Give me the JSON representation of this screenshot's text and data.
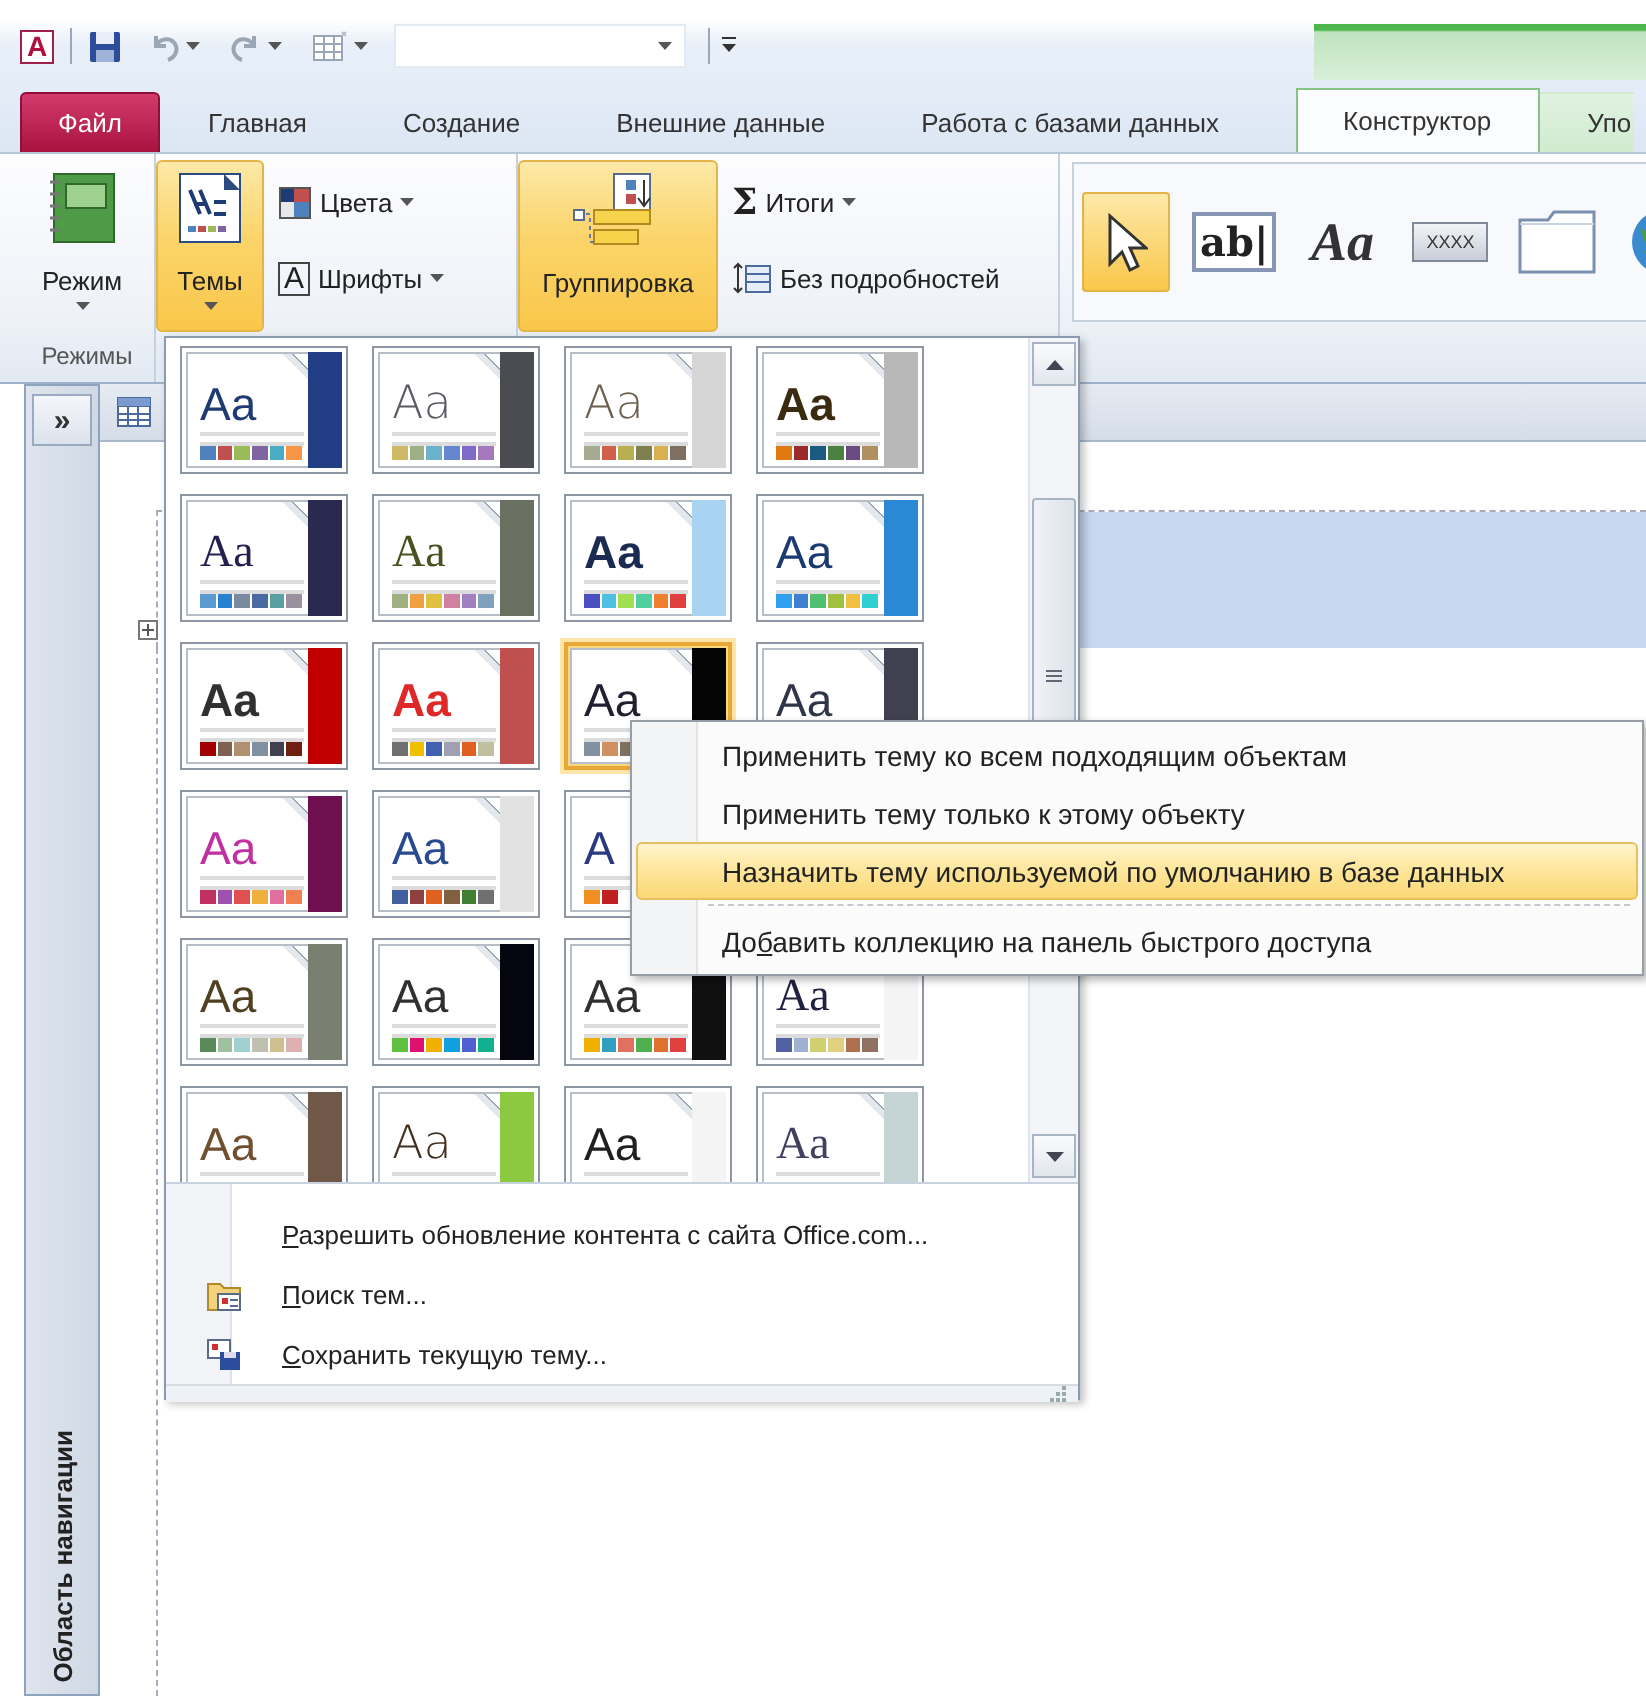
{
  "quick_access": {
    "app_icon": "A"
  },
  "tabs": [
    {
      "label": "Файл",
      "kind": "file",
      "selected": false
    },
    {
      "label": "Главная",
      "kind": "tab",
      "selected": false
    },
    {
      "label": "Создание",
      "kind": "tab",
      "selected": false
    },
    {
      "label": "Внешние данные",
      "kind": "tab",
      "selected": false
    },
    {
      "label": "Работа с базами данных",
      "kind": "tab",
      "selected": false
    },
    {
      "label": "Конструктор",
      "kind": "context",
      "selected": true
    },
    {
      "label": "Упо",
      "kind": "context",
      "selected": false
    }
  ],
  "ribbon": {
    "views": {
      "button": "Режим",
      "group_label": "Режимы"
    },
    "themes": {
      "button": {
        "label": "Темы",
        "pressed": true
      },
      "colors": "Цвета",
      "fonts": {
        "glyph": "A",
        "label": "Шрифты"
      }
    },
    "grouping": {
      "button": {
        "label": "Группировка",
        "pressed": true
      },
      "totals": {
        "glyph": "Σ",
        "label": "Итоги"
      },
      "hide_details": "Без подробностей"
    },
    "controls": [
      {
        "kind": "pointer",
        "selected": true
      },
      {
        "kind": "textbox",
        "glyph": "ab|",
        "selected": false
      },
      {
        "kind": "label",
        "glyph": "Aa",
        "selected": false
      },
      {
        "kind": "button",
        "glyph": "XXXX",
        "selected": false
      },
      {
        "kind": "tab",
        "selected": false
      },
      {
        "kind": "hyperlink",
        "selected": false
      }
    ]
  },
  "navigation_pane": {
    "toggle": "»",
    "title": "Область навигации"
  },
  "theme_gallery": {
    "rows": [
      [
        {
          "sample": {
            "text": "Aa",
            "color": "#1f3b73"
          },
          "kind": "sans",
          "color": "#223f85",
          "palette": [
            {
              "color": "#4f81bd"
            },
            {
              "color": "#c0504d"
            },
            {
              "color": "#9bbb59"
            },
            {
              "color": "#8064a2"
            },
            {
              "color": "#4bacc6"
            },
            {
              "color": "#f79646"
            }
          ],
          "selected": false
        },
        {
          "sample": {
            "text": "Aa",
            "color": "#5a5a62"
          },
          "kind": "light",
          "color": "#4b4b52",
          "palette": [
            {
              "color": "#ceb966"
            },
            {
              "color": "#9cb084"
            },
            {
              "color": "#6bb1c9"
            },
            {
              "color": "#6585cf"
            },
            {
              "color": "#7e6bc9"
            },
            {
              "color": "#a379bb"
            }
          ],
          "selected": false
        },
        {
          "sample": {
            "text": "Aa",
            "color": "#6b6050"
          },
          "kind": "light",
          "color": "#d6d6d6",
          "palette": [
            {
              "color": "#a5ab91"
            },
            {
              "color": "#d0604a"
            },
            {
              "color": "#b8b050"
            },
            {
              "color": "#7f7f50"
            },
            {
              "color": "#d8b050"
            },
            {
              "color": "#7f6f60"
            }
          ],
          "selected": false
        },
        {
          "sample": {
            "text": "Aa",
            "color": "#3a2a10"
          },
          "kind": "bold",
          "color": "#b8b8b8",
          "palette": [
            {
              "color": "#e07a10"
            },
            {
              "color": "#9c2a2a"
            },
            {
              "color": "#1a5a80"
            },
            {
              "color": "#4a8040"
            },
            {
              "color": "#6a4a80"
            },
            {
              "color": "#b09060"
            }
          ],
          "selected": false
        }
      ],
      [
        {
          "sample": {
            "text": "Aa",
            "color": "#232050"
          },
          "kind": "serif",
          "color": "#2a2a50",
          "palette": [
            {
              "color": "#5a9ad0"
            },
            {
              "color": "#2a80d0"
            },
            {
              "color": "#7a8aa0"
            },
            {
              "color": "#4a6aa0"
            },
            {
              "color": "#5aa0a0"
            },
            {
              "color": "#9a90a0"
            }
          ],
          "selected": false
        },
        {
          "sample": {
            "text": "Aa",
            "color": "#4a5020"
          },
          "kind": "serif",
          "color": "#6a7060",
          "palette": [
            {
              "color": "#a0b080"
            },
            {
              "color": "#f0a040"
            },
            {
              "color": "#e0c040"
            },
            {
              "color": "#d080a0"
            },
            {
              "color": "#a080c0"
            },
            {
              "color": "#80a0c0"
            }
          ],
          "selected": false
        },
        {
          "sample": {
            "text": "Aa",
            "color": "#1a2a50"
          },
          "kind": "bold",
          "color": "#a8d4f2",
          "palette": [
            {
              "color": "#4a50c0"
            },
            {
              "color": "#50c0e0"
            },
            {
              "color": "#a0e050"
            },
            {
              "color": "#50d0a0"
            },
            {
              "color": "#f08030"
            },
            {
              "color": "#e04040"
            }
          ],
          "selected": false
        },
        {
          "sample": {
            "text": "Aa",
            "color": "#1a3a70"
          },
          "kind": "sans",
          "color": "#2a88d4",
          "palette": [
            {
              "color": "#30a0f0"
            },
            {
              "color": "#4080d0"
            },
            {
              "color": "#50c070"
            },
            {
              "color": "#a0c040"
            },
            {
              "color": "#f0c040"
            },
            {
              "color": "#30d0d0"
            }
          ],
          "selected": false
        }
      ],
      [
        {
          "sample": {
            "text": "Aa",
            "color": "#303030"
          },
          "kind": "bold",
          "color": "#c00000",
          "palette": [
            {
              "color": "#a00000"
            },
            {
              "color": "#806050"
            },
            {
              "color": "#b09070"
            },
            {
              "color": "#8090a0"
            },
            {
              "color": "#404050"
            },
            {
              "color": "#702010"
            }
          ],
          "selected": false
        },
        {
          "sample": {
            "text": "Aa",
            "color": "#e02828"
          },
          "kind": "bold",
          "color": "#c05050",
          "palette": [
            {
              "color": "#707070"
            },
            {
              "color": "#f0c000"
            },
            {
              "color": "#4060b0"
            },
            {
              "color": "#a0a0b0"
            },
            {
              "color": "#e06020"
            },
            {
              "color": "#c0c0a0"
            }
          ],
          "selected": false
        },
        {
          "sample": {
            "text": "Aa",
            "color": "#202030"
          },
          "kind": "sans",
          "color": "#050505",
          "palette": [
            {
              "color": "#8090a0"
            },
            {
              "color": "#d09060"
            },
            {
              "color": "#807060"
            }
          ],
          "selected": true
        },
        {
          "sample": {
            "text": "Aa",
            "color": "#303548"
          },
          "kind": "sans",
          "color": "#404050",
          "selected": false
        }
      ],
      [
        {
          "sample": {
            "text": "Aa",
            "color": "#c030a0"
          },
          "kind": "sans",
          "color": "#701050",
          "palette": [
            {
              "color": "#c03060"
            },
            {
              "color": "#a050b0"
            },
            {
              "color": "#e05050"
            },
            {
              "color": "#f0b040"
            },
            {
              "color": "#e070a0"
            },
            {
              "color": "#f08050"
            }
          ],
          "selected": false
        },
        {
          "sample": {
            "text": "Aa",
            "color": "#2a4a90"
          },
          "kind": "sans",
          "color": "#e2e2e2",
          "palette": [
            {
              "color": "#4060a0"
            },
            {
              "color": "#904040"
            },
            {
              "color": "#e06020"
            },
            {
              "color": "#806040"
            },
            {
              "color": "#408030"
            },
            {
              "color": "#707070"
            }
          ],
          "selected": false
        },
        {
          "sample": {
            "text": "A",
            "color": "#2a3a80"
          },
          "kind": "sans",
          "palette": [
            {
              "color": "#f09020"
            },
            {
              "color": "#c02020"
            }
          ],
          "selected": false
        }
      ],
      [
        {
          "sample": {
            "text": "Aa",
            "color": "#504020"
          },
          "kind": "sans",
          "color": "#7a8070",
          "palette": [
            {
              "color": "#5a8a5a"
            },
            {
              "color": "#a0c0a0"
            },
            {
              "color": "#a0d0d0"
            },
            {
              "color": "#c0c0b0"
            },
            {
              "color": "#d0c090"
            },
            {
              "color": "#e0b0b0"
            }
          ],
          "selected": false
        },
        {
          "sample": {
            "text": "Aa",
            "color": "#303030"
          },
          "kind": "sans",
          "color": "#050510",
          "palette": [
            {
              "color": "#60c040"
            },
            {
              "color": "#e01070"
            },
            {
              "color": "#f0b000"
            },
            {
              "color": "#10a0e0"
            },
            {
              "color": "#5060d0"
            },
            {
              "color": "#10b090"
            }
          ],
          "selected": false
        },
        {
          "sample": {
            "text": "Aa",
            "color": "#303030"
          },
          "kind": "sans",
          "color": "#101010",
          "palette": [
            {
              "color": "#f0b000"
            },
            {
              "color": "#30a0c0"
            },
            {
              "color": "#e07060"
            },
            {
              "color": "#50b050"
            },
            {
              "color": "#e07030"
            },
            {
              "color": "#e04040"
            }
          ],
          "selected": false
        },
        {
          "sample": {
            "text": "Aa",
            "color": "#202040"
          },
          "kind": "serif",
          "color": "#f4f4f4",
          "palette": [
            {
              "color": "#5060a0"
            },
            {
              "color": "#a0b0d0"
            },
            {
              "color": "#d0d070"
            },
            {
              "color": "#e0d080"
            },
            {
              "color": "#b07050"
            },
            {
              "color": "#907060"
            }
          ],
          "selected": false
        }
      ],
      [
        {
          "sample": {
            "text": "Aa",
            "color": "#705030"
          },
          "kind": "sans",
          "color": "#705848",
          "selected": false
        },
        {
          "sample": {
            "text": "Aa",
            "color": "#403020"
          },
          "kind": "light",
          "color": "#8cc840",
          "selected": false
        },
        {
          "sample": {
            "text": "Aa",
            "color": "#202020"
          },
          "kind": "sans",
          "color": "#f4f4f4",
          "selected": false
        },
        {
          "sample": {
            "text": "Aa",
            "color": "#404060"
          },
          "kind": "serif",
          "color": "#c4d4d4",
          "selected": false
        }
      ]
    ],
    "commands": [
      {
        "kind": "plain",
        "text": {
          "key": "Р",
          "after": "азрешить обновление контента с сайта Office.com..."
        }
      },
      {
        "kind": "browse",
        "text": {
          "key": "П",
          "after": "оиск тем..."
        }
      },
      {
        "kind": "save",
        "text": {
          "key": "С",
          "after": "охранить текущую тему..."
        }
      }
    ]
  },
  "context_menu": {
    "items": [
      {
        "kind": "item",
        "text": {
          "before": "Применить тему ко всем подходящим объектам"
        },
        "selected": false
      },
      {
        "kind": "item",
        "text": {
          "before": "Применить тему только к этому объекту"
        },
        "selected": false
      },
      {
        "kind": "item",
        "text": {
          "before": "Назначить тему используемой по умолчанию в базе данных"
        },
        "selected": true
      },
      {
        "kind": "separator"
      },
      {
        "kind": "item",
        "text": {
          "before": "До",
          "key": "б",
          "after": "авить коллекцию на панель быстрого доступа"
        },
        "selected": false
      }
    ]
  }
}
